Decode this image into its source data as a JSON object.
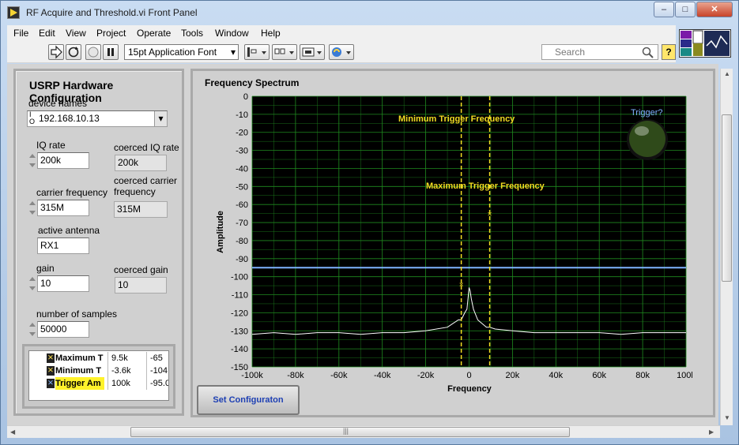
{
  "window": {
    "title": "RF Acquire and Threshold.vi Front Panel",
    "controls": {
      "minimize": "–",
      "maximize": "□",
      "close": "✕"
    }
  },
  "menu": [
    "File",
    "Edit",
    "View",
    "Project",
    "Operate",
    "Tools",
    "Window",
    "Help"
  ],
  "toolbar": {
    "font": "15pt Application Font",
    "search_placeholder": "Search",
    "help_label": "?"
  },
  "config": {
    "title": "USRP Hardware Configuration",
    "device_names_label": "device names",
    "device_names_value": "192.168.10.13",
    "iq_rate_label": "IQ rate",
    "iq_rate_value": "200k",
    "coerced_iq_rate_label": "coerced IQ rate",
    "coerced_iq_rate_value": "200k",
    "carrier_frequency_label": "carrier frequency",
    "carrier_frequency_value": "315M",
    "coerced_carrier_frequency_label_1": "coerced carrier",
    "coerced_carrier_frequency_label_2": "frequency",
    "coerced_carrier_frequency_value": "315M",
    "active_antenna_label": "active antenna",
    "active_antenna_value": "RX1",
    "gain_label": "gain",
    "gain_value": "10",
    "coerced_gain_label": "coerced gain",
    "coerced_gain_value": "10",
    "number_of_samples_label": "number of samples",
    "number_of_samples_value": "50000"
  },
  "cursors": [
    {
      "name": "Maximum T",
      "x": "9.5k",
      "y": "-65",
      "highlight": false
    },
    {
      "name": "Minimum T",
      "x": "-3.6k",
      "y": "-104.",
      "highlight": false
    },
    {
      "name": "Trigger Am",
      "x": "100k",
      "y": "-95.0",
      "highlight": true
    }
  ],
  "graph": {
    "title": "Frequency Spectrum",
    "set_button": "Set Configuraton",
    "trigger_label": "Trigger?",
    "annotation_min": "Minimum Trigger Frequency",
    "annotation_max": "Maximum Trigger Frequency"
  },
  "colors": {
    "plot_bg": "#000000",
    "grid": "#1f8a1f",
    "spectrum": "#ffffff",
    "cursor_line": "#f2dc22",
    "trigger_line": "#7fb3ff",
    "led_off": "#2f4a1a"
  },
  "chart_data": {
    "type": "line",
    "title": "",
    "xlabel": "Frequency",
    "ylabel": "Amplitude",
    "xlim": [
      -100000,
      100000
    ],
    "ylim": [
      -150,
      0
    ],
    "grid": true,
    "x_ticks": [
      "-100k",
      "-80k",
      "-60k",
      "-40k",
      "-20k",
      "0",
      "20k",
      "40k",
      "60k",
      "80k",
      "100k"
    ],
    "y_ticks": [
      "0",
      "-10",
      "-20",
      "-30",
      "-40",
      "-50",
      "-60",
      "-70",
      "-80",
      "-90",
      "-100",
      "-110",
      "-120",
      "-130",
      "-140",
      "-150"
    ],
    "series": [
      {
        "x": [
          -100000,
          -90000,
          -80000,
          -70000,
          -60000,
          -50000,
          -40000,
          -30000,
          -20000,
          -10000,
          -5000,
          -3600,
          -2000,
          -1000,
          0,
          500,
          1000,
          2000,
          4000,
          6000,
          8000,
          9500,
          12000,
          20000,
          30000,
          40000,
          50000,
          60000,
          70000,
          80000,
          90000,
          100000
        ],
        "values": [
          -132,
          -131,
          -132,
          -131,
          -131,
          -132,
          -131,
          -131,
          -130,
          -128,
          -124,
          -124,
          -120,
          -118,
          -106,
          -108,
          -112,
          -118,
          -124,
          -126,
          -128,
          -128,
          -129,
          -130,
          -131,
          -131,
          -131,
          -131,
          -132,
          -131,
          -131,
          -131
        ]
      }
    ],
    "cursors": [
      {
        "name": "Minimum Trigger Frequency",
        "x": -3600,
        "y": -104
      },
      {
        "name": "Maximum Trigger Frequency",
        "x": 9500,
        "y": -65
      }
    ],
    "threshold": {
      "name": "Trigger Amplitude",
      "y": -95
    }
  }
}
